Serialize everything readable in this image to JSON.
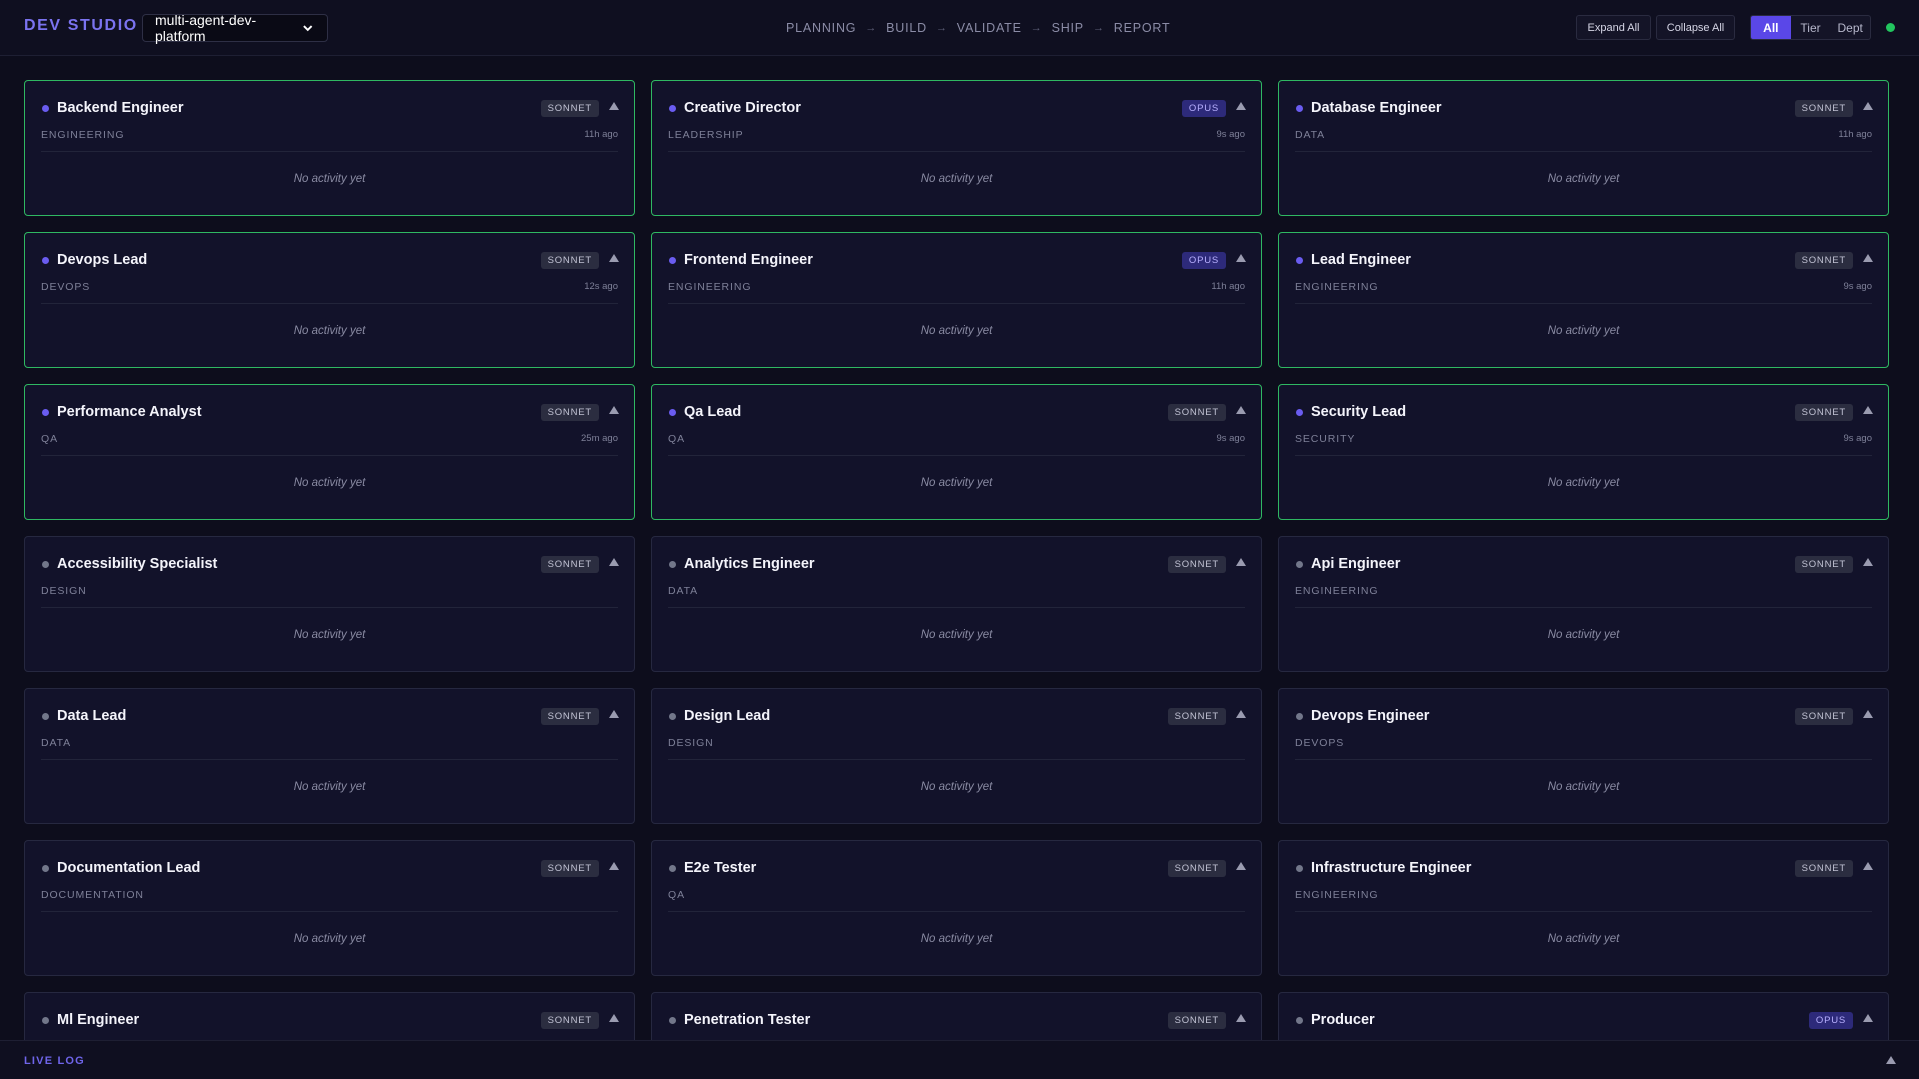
{
  "header": {
    "brand": "DEV STUDIO",
    "project": "multi-agent-dev-platform",
    "pipeline": [
      "PLANNING",
      "BUILD",
      "VALIDATE",
      "SHIP",
      "REPORT"
    ],
    "pipeline_arrow": "→",
    "expand_all": "Expand All",
    "collapse_all": "Collapse All",
    "view_options": [
      "All",
      "Tier",
      "Dept"
    ],
    "active_view": "All",
    "status_color": "#22c55e"
  },
  "agents": [
    {
      "name": "Backend Engineer",
      "model": "SONNET",
      "dept": "ENGINEERING",
      "time": "11h ago",
      "activity": "No activity yet",
      "active": true
    },
    {
      "name": "Creative Director",
      "model": "OPUS",
      "dept": "LEADERSHIP",
      "time": "9s ago",
      "activity": "No activity yet",
      "active": true
    },
    {
      "name": "Database Engineer",
      "model": "SONNET",
      "dept": "DATA",
      "time": "11h ago",
      "activity": "No activity yet",
      "active": true
    },
    {
      "name": "Devops Lead",
      "model": "SONNET",
      "dept": "DEVOPS",
      "time": "12s ago",
      "activity": "No activity yet",
      "active": true
    },
    {
      "name": "Frontend Engineer",
      "model": "OPUS",
      "dept": "ENGINEERING",
      "time": "11h ago",
      "activity": "No activity yet",
      "active": true
    },
    {
      "name": "Lead Engineer",
      "model": "SONNET",
      "dept": "ENGINEERING",
      "time": "9s ago",
      "activity": "No activity yet",
      "active": true
    },
    {
      "name": "Performance Analyst",
      "model": "SONNET",
      "dept": "QA",
      "time": "25m ago",
      "activity": "No activity yet",
      "active": true
    },
    {
      "name": "Qa Lead",
      "model": "SONNET",
      "dept": "QA",
      "time": "9s ago",
      "activity": "No activity yet",
      "active": true
    },
    {
      "name": "Security Lead",
      "model": "SONNET",
      "dept": "SECURITY",
      "time": "9s ago",
      "activity": "No activity yet",
      "active": true
    },
    {
      "name": "Accessibility Specialist",
      "model": "SONNET",
      "dept": "DESIGN",
      "time": "",
      "activity": "No activity yet",
      "active": false
    },
    {
      "name": "Analytics Engineer",
      "model": "SONNET",
      "dept": "DATA",
      "time": "",
      "activity": "No activity yet",
      "active": false
    },
    {
      "name": "Api Engineer",
      "model": "SONNET",
      "dept": "ENGINEERING",
      "time": "",
      "activity": "No activity yet",
      "active": false
    },
    {
      "name": "Data Lead",
      "model": "SONNET",
      "dept": "DATA",
      "time": "",
      "activity": "No activity yet",
      "active": false
    },
    {
      "name": "Design Lead",
      "model": "SONNET",
      "dept": "DESIGN",
      "time": "",
      "activity": "No activity yet",
      "active": false
    },
    {
      "name": "Devops Engineer",
      "model": "SONNET",
      "dept": "DEVOPS",
      "time": "",
      "activity": "No activity yet",
      "active": false
    },
    {
      "name": "Documentation Lead",
      "model": "SONNET",
      "dept": "DOCUMENTATION",
      "time": "",
      "activity": "No activity yet",
      "active": false
    },
    {
      "name": "E2e Tester",
      "model": "SONNET",
      "dept": "QA",
      "time": "",
      "activity": "No activity yet",
      "active": false
    },
    {
      "name": "Infrastructure Engineer",
      "model": "SONNET",
      "dept": "ENGINEERING",
      "time": "",
      "activity": "No activity yet",
      "active": false
    },
    {
      "name": "Ml Engineer",
      "model": "SONNET",
      "dept": "",
      "time": "",
      "activity": "",
      "active": false
    },
    {
      "name": "Penetration Tester",
      "model": "SONNET",
      "dept": "",
      "time": "",
      "activity": "",
      "active": false
    },
    {
      "name": "Producer",
      "model": "OPUS",
      "dept": "",
      "time": "",
      "activity": "",
      "active": false
    }
  ],
  "live_log": {
    "label": "LIVE LOG"
  },
  "colors": {
    "accent": "#5a47e8",
    "active_border": "#2fb862",
    "opus_badge": "#2d2a7a"
  }
}
